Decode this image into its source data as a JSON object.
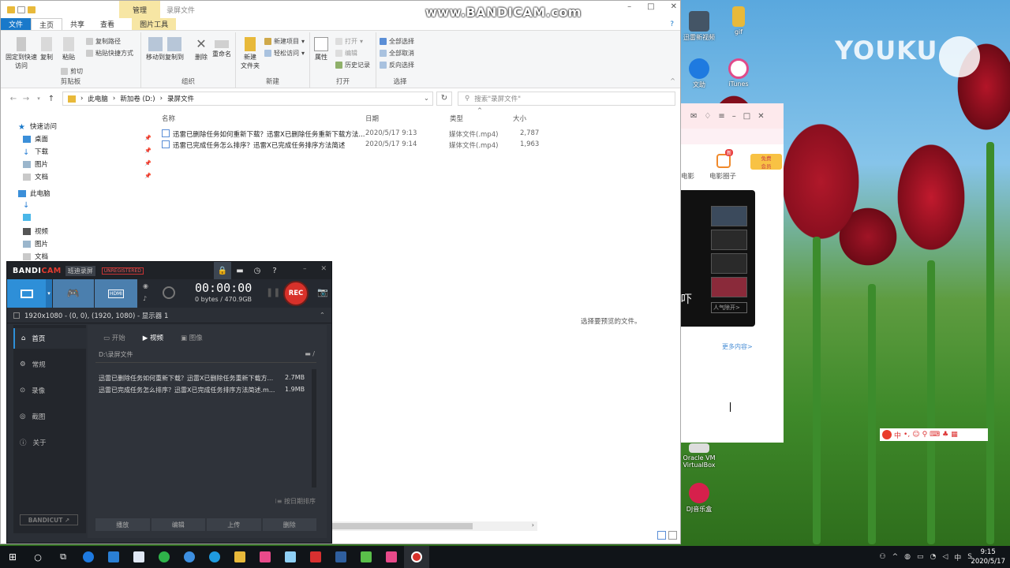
{
  "watermark": "www.BANDICAM.com",
  "explorer": {
    "title": "录屏文件",
    "tab_manage": "管理",
    "tabs": [
      "文件",
      "主页",
      "共享",
      "查看"
    ],
    "tab_picture_tools": "图片工具",
    "ribbon": {
      "clipboard": {
        "label": "剪贴板",
        "pin": "固定到快速访问",
        "copy": "复制",
        "paste": "粘贴",
        "copy_path": "复制路径",
        "paste_shortcut": "粘贴快捷方式",
        "cut": "剪切"
      },
      "organize": {
        "label": "组织",
        "move_to": "移动到",
        "copy_to": "复制到",
        "delete": "删除",
        "rename": "重命名"
      },
      "new": {
        "label": "新建",
        "new_folder": "新建\n文件夹",
        "new_item": "新建项目",
        "easy_access": "轻松访问"
      },
      "open": {
        "label": "打开",
        "properties": "属性",
        "open": "打开",
        "edit": "编辑",
        "history": "历史记录"
      },
      "select": {
        "label": "选择",
        "select_all": "全部选择",
        "select_none": "全部取消",
        "invert": "反向选择"
      }
    },
    "address": {
      "crumbs": [
        "此电脑",
        "新加卷 (D:)",
        "录屏文件"
      ],
      "search_placeholder": "搜索\"录屏文件\""
    },
    "nav": {
      "quick_access": "快速访问",
      "items": [
        "桌面",
        "下载",
        "图片",
        "文档"
      ],
      "this_pc": "此电脑",
      "pc_items": [
        "视频",
        "图片",
        "文档"
      ]
    },
    "columns": {
      "name": "名称",
      "date": "日期",
      "type": "类型",
      "size": "大小"
    },
    "files": [
      {
        "name": "迅雷已删除任务如何重新下载？迅雷X已删除任务重新下载方法...",
        "date": "2020/5/17 9:13",
        "type": "媒体文件(.mp4)",
        "size": "2,787"
      },
      {
        "name": "迅雷已完成任务怎么排序？迅雷X已完成任务排序方法简述",
        "date": "2020/5/17 9:14",
        "type": "媒体文件(.mp4)",
        "size": "1,963"
      }
    ],
    "preview_text": "选择要预览的文件。"
  },
  "bandicam": {
    "logo_a": "BANDI",
    "logo_b": "CAM",
    "subtitle": "班迪录屏",
    "unregistered": "UNREGISTERED",
    "hdmi": "HDMI",
    "timer": "00:00:00",
    "bytes": "0 bytes / 470.9GB",
    "rec": "REC",
    "resolution": "1920x1080 - (0, 0), (1920, 1080) - 显示器 1",
    "sidebar": [
      "首页",
      "常规",
      "录像",
      "截图",
      "关于"
    ],
    "tabs": [
      "开始",
      "视频",
      "图像"
    ],
    "path": "D:\\录屏文件",
    "files": [
      {
        "name": "迅雷已删除任务如何重新下载？迅雷X已删除任务重新下载方...",
        "size": "2.7MB"
      },
      {
        "name": "迅雷已完成任务怎么排序？迅雷X已完成任务排序方法简述.m...",
        "size": "1.9MB"
      }
    ],
    "sort": "按日期排序",
    "buttons": [
      "播放",
      "编辑",
      "上传",
      "删除"
    ],
    "bandicut": "BANDICUT ↗"
  },
  "xunlei": {
    "nav": [
      "电影",
      "电影圈子"
    ],
    "badge_new": "新",
    "vip": "免费\n会员",
    "big_char": "吓",
    "popular": "人气除开>",
    "more": "更多内容>"
  },
  "desktop": {
    "icons": [
      {
        "label": "迅雷新视频",
        "color": "#445566"
      },
      {
        "label": "gif",
        "color": "#e8b93a"
      },
      {
        "label": "文助",
        "color": "#1e7ae0"
      },
      {
        "label": "iTunes",
        "color": "#e04a8a"
      },
      {
        "label": "Oracle VM\nVirtualBox",
        "color": "#2f5f9e"
      },
      {
        "label": "DJ音乐盒",
        "color": "#d6204c"
      }
    ],
    "youku": "YOUKU",
    "ime": "中"
  },
  "taskbar": {
    "time": "9:15",
    "date": "2020/5/17"
  },
  "colors": {
    "accent": "#1979ca",
    "rec": "#d8312a",
    "bandicam_blue": "#2e8fd8"
  }
}
